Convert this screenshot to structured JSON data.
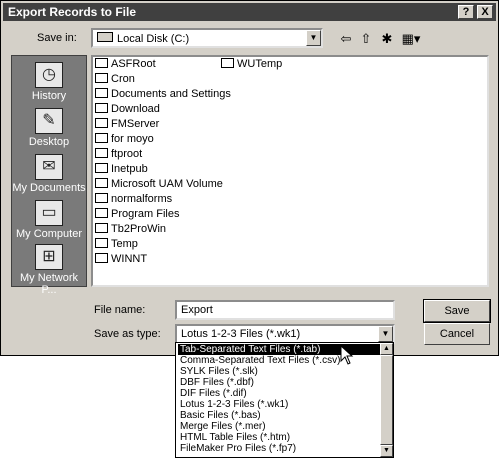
{
  "window": {
    "title": "Export Records to File",
    "help_btn": "?",
    "close_btn": "X"
  },
  "save_in": {
    "label": "Save in:",
    "value": "Local Disk (C:)",
    "drive_icon": "drive-icon"
  },
  "toolbar": {
    "back": "⇦",
    "up": "⇧",
    "new_folder": "✱",
    "view": "▦▾"
  },
  "places": [
    {
      "label": "History",
      "icon": "history-icon",
      "glyph": "◷"
    },
    {
      "label": "Desktop",
      "icon": "desktop-icon",
      "glyph": "✎"
    },
    {
      "label": "My Documents",
      "icon": "my-documents-icon",
      "glyph": "✉"
    },
    {
      "label": "My Computer",
      "icon": "my-computer-icon",
      "glyph": "▭"
    },
    {
      "label": "My Network P...",
      "icon": "my-network-icon",
      "glyph": "⊞"
    }
  ],
  "files_col1": [
    "ASFRoot",
    "Cron",
    "Documents and Settings",
    "Download",
    "FMServer",
    "for moyo",
    "ftproot",
    "Inetpub",
    "Microsoft UAM Volume",
    "normalforms",
    "Program Files",
    "Tb2ProWin",
    "Temp",
    "WINNT"
  ],
  "files_col2": [
    "WUTemp"
  ],
  "file_name": {
    "label": "File name:",
    "value": "Export"
  },
  "save_as_type": {
    "label": "Save as type:",
    "value": "Lotus 1-2-3 Files (*.wk1)"
  },
  "buttons": {
    "save": "Save",
    "cancel": "Cancel"
  },
  "type_options": [
    "Tab-Separated Text Files (*.tab)",
    "Comma-Separated Text Files (*.csv)",
    "SYLK Files (*.slk)",
    "DBF Files (*.dbf)",
    "DIF Files (*.dif)",
    "Lotus 1-2-3 Files (*.wk1)",
    "Basic Files (*.bas)",
    "Merge Files (*.mer)",
    "HTML Table Files (*.htm)",
    "FileMaker Pro Files (*.fp7)"
  ],
  "selected_option_index": 0
}
